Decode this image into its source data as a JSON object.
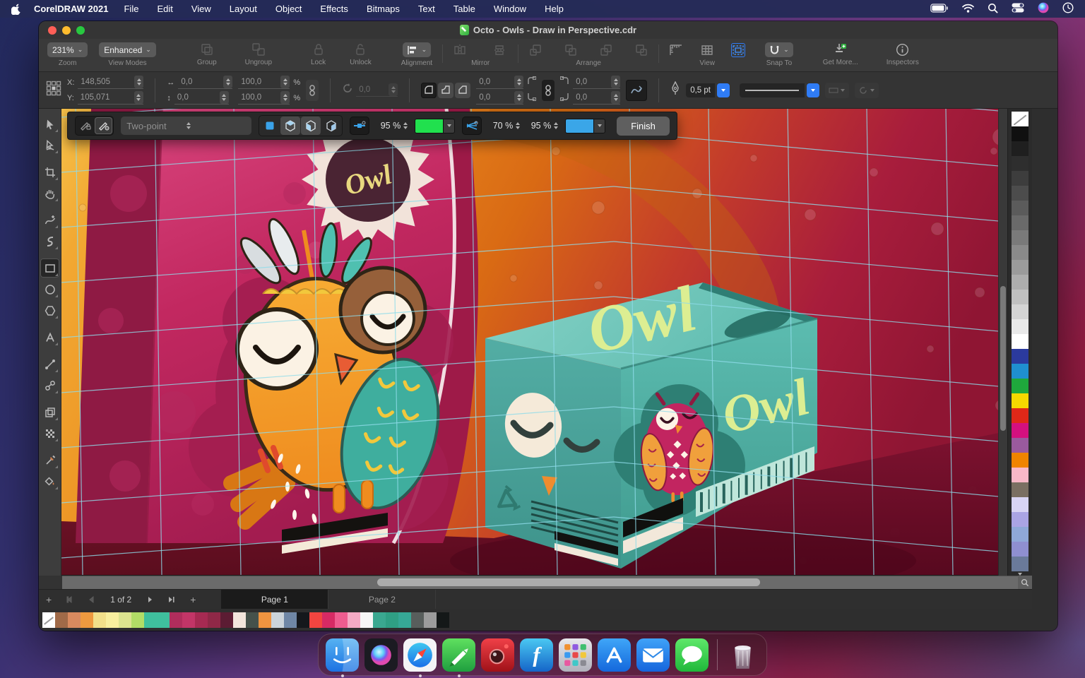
{
  "menu_bar": {
    "app_name": "CorelDRAW 2021",
    "menus": [
      "File",
      "Edit",
      "View",
      "Layout",
      "Object",
      "Effects",
      "Bitmaps",
      "Text",
      "Table",
      "Window",
      "Help"
    ],
    "status_icons": [
      "battery",
      "wifi",
      "search",
      "control-center",
      "siri",
      "clock"
    ]
  },
  "window": {
    "title": "Octo - Owls - Draw in Perspective.cdr",
    "toolbar": {
      "zoom": {
        "value": "231%",
        "label": "Zoom"
      },
      "view_modes": {
        "value": "Enhanced",
        "label": "View Modes"
      },
      "group_label": "Group",
      "ungroup_label": "Ungroup",
      "lock_label": "Lock",
      "unlock_label": "Unlock",
      "alignment_label": "Alignment",
      "mirror_label": "Mirror",
      "arrange_label": "Arrange",
      "view_label": "View",
      "snap_to_label": "Snap To",
      "get_more_label": "Get More...",
      "inspectors_label": "Inspectors"
    },
    "property_bar": {
      "x_label": "X:",
      "x_value": "148,505",
      "y_label": "Y:",
      "y_value": "105,071",
      "dx_value": "0,0",
      "dy_value": "0,0",
      "scale_w_value": "100,0",
      "scale_h_value": "100,0",
      "percent": "%",
      "rotation_value": "0,0",
      "corner_tl": "0,0",
      "corner_bl": "0,0",
      "corner_tr": "0,0",
      "corner_br": "0,0",
      "outline_width": "0,5 pt"
    },
    "perspective_bar": {
      "type_value": "Two-point",
      "grid_opacity": "95 %",
      "grid_color": "#21e04e",
      "horizon_opacity": "70 %",
      "plane_opacity": "95 %",
      "line_color": "#3aa6e8",
      "finish_label": "Finish"
    },
    "toolbox_tools": [
      "pick-tool",
      "shape-tool",
      "crop-tool",
      "pan-tool",
      "freehand-tool",
      "artistic-media-tool",
      "rectangle-tool",
      "ellipse-tool",
      "polygon-tool",
      "text-tool",
      "line-tool",
      "connector-tool",
      "drop-shadow-tool",
      "mesh-fill-tool",
      "eyedropper-tool",
      "interactive-fill-tool"
    ],
    "active_tool": "rectangle-tool",
    "navigator": {
      "add_page": "+",
      "page_info": "1 of 2",
      "next": "›",
      "last": "»",
      "first": "«",
      "prev": "‹",
      "tabs": [
        {
          "label": "Page 1",
          "active": true
        },
        {
          "label": "Page 2",
          "active": false
        }
      ]
    },
    "bottom_palette": [
      "none",
      "#a06a48",
      "#d88a5f",
      "#ee9a3f",
      "#f2e08a",
      "#f8ef9e",
      "#dce48f",
      "#b2dd66",
      "#3fbf9d",
      "#3fbf9d",
      "#b02d5c",
      "#c23567",
      "#a62a52",
      "#8f2847",
      "#5c1c33",
      "#f2e5dc",
      "#45514b",
      "#ef9440",
      "#ccd4da",
      "#6f87a6",
      "#15181c",
      "#f24540",
      "#d62a64",
      "#ee5c8f",
      "#f4aac4",
      "#f6f6f6",
      "#3aa890",
      "#2f9f84",
      "#36a896",
      "#585e5c",
      "#9c9c9c",
      "#141818"
    ],
    "right_palette": [
      "none",
      "#101010",
      "#1f1f1f",
      "#2e2e2e",
      "#3d3d3d",
      "#4c4c4c",
      "#5b5b5b",
      "#6a6a6a",
      "#7a7a7a",
      "#8a8a8a",
      "#9b9b9b",
      "#adadad",
      "#c0c0c0",
      "#d4d4d4",
      "#e9e9e9",
      "#ffffff",
      "#2b3a9e",
      "#1f8fd0",
      "#1fa83c",
      "#f5d800",
      "#e02818",
      "#d4107f",
      "#9a5a9e",
      "#ef8400",
      "#f8b8c8",
      "#7a6f62",
      "#d8d4f4",
      "#aaa4e4",
      "#8fa8d8",
      "#8f8fd0",
      "#6a7a9a"
    ],
    "canvas": {
      "brand_text": "Owl",
      "grid_color": "#8fdcea",
      "bag_color": "#c22860",
      "box_color": "#4aa89e",
      "background_orange": "#ea8c1f",
      "background_red": "#a81d3c"
    }
  },
  "dock": {
    "items": [
      {
        "name": "finder",
        "running": true
      },
      {
        "name": "siri",
        "running": false
      },
      {
        "name": "safari",
        "running": true
      },
      {
        "name": "coreldraw",
        "running": true
      },
      {
        "name": "photo-app",
        "running": false
      },
      {
        "name": "font-manager",
        "running": false
      },
      {
        "name": "launchpad",
        "running": false
      },
      {
        "name": "app-store",
        "running": false
      },
      {
        "name": "mail",
        "running": false
      },
      {
        "name": "messages",
        "running": false
      },
      {
        "name": "trash",
        "running": false
      }
    ]
  }
}
